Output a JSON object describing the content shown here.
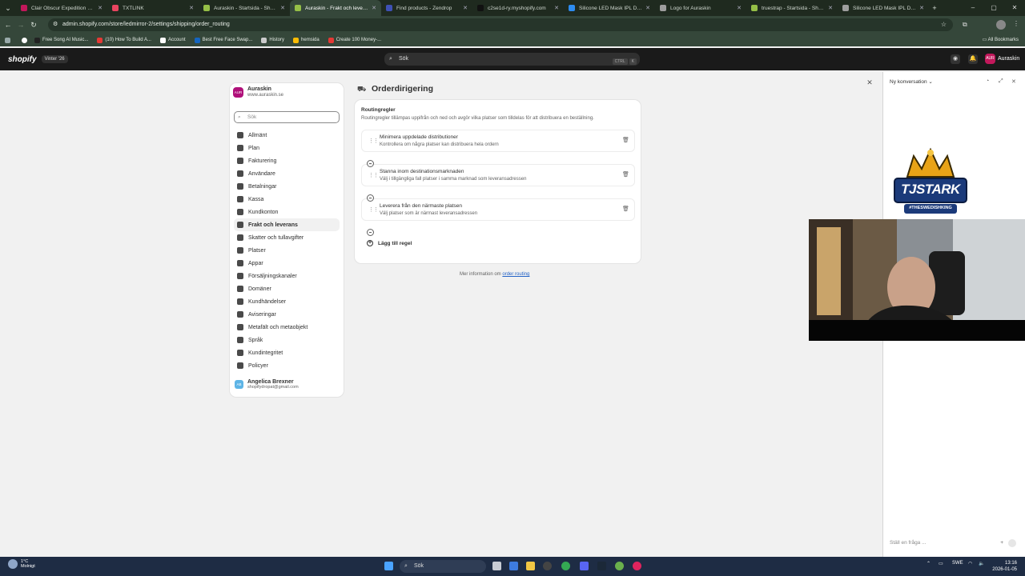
{
  "browser": {
    "tabs": [
      {
        "label": "Clair Obscur Expedition 33 – E",
        "color": "#c2185b"
      },
      {
        "label": "TXTLINK",
        "color": "#e94560"
      },
      {
        "label": "Auraskin - Startsida - Shopify",
        "color": "#95bf47"
      },
      {
        "label": "Auraskin - Frakt och leverans",
        "color": "#95bf47",
        "active": true
      },
      {
        "label": "Find products - Zendrop",
        "color": "#3f51b5"
      },
      {
        "label": "c2se1d-ry.myshopify.com",
        "color": "#111111"
      },
      {
        "label": "Silicone LED Mask IPL Device",
        "color": "#2d8cf0"
      },
      {
        "label": "Logo for Auraskin",
        "color": "#9e9e9e"
      },
      {
        "label": "truestrap - Startsida - Shopify",
        "color": "#95bf47"
      },
      {
        "label": "Silicone LED Mask IPL Device",
        "color": "#9e9e9e"
      }
    ],
    "url": "admin.shopify.com/store/ledmirror-2/settings/shipping/order_routing",
    "bookmarks": [
      {
        "label": "Free Song AI Music...",
        "color": "#222"
      },
      {
        "label": "(10) How To Build A...",
        "color": "#e53935"
      },
      {
        "label": "Account",
        "color": "#ffffff"
      },
      {
        "label": "Best Free Face Swap...",
        "color": "#1565c0"
      },
      {
        "label": "History",
        "color": "#cccccc"
      },
      {
        "label": "hemsida",
        "color": "#fbbc05"
      },
      {
        "label": "Create 100 Money-...",
        "color": "#e53935"
      }
    ],
    "all_bookmarks": "All Bookmarks"
  },
  "shopify": {
    "logo": "shopify",
    "edition": "Vinter '26",
    "search_placeholder": "Sök",
    "kbd1": "CTRL",
    "kbd2": "K",
    "store_initials": "AUR",
    "store_button": "Auraskin"
  },
  "sidebar": {
    "store_initials": "AUR",
    "store_name": "Auraskin",
    "store_url": "www.auraskin.se",
    "search_placeholder": "Sök",
    "items": [
      {
        "label": "Allmänt"
      },
      {
        "label": "Plan"
      },
      {
        "label": "Fakturering"
      },
      {
        "label": "Användare"
      },
      {
        "label": "Betalningar"
      },
      {
        "label": "Kassa"
      },
      {
        "label": "Kundkonton"
      },
      {
        "label": "Frakt och leverans",
        "selected": true
      },
      {
        "label": "Skatter och tullavgifter"
      },
      {
        "label": "Platser"
      },
      {
        "label": "Appar"
      },
      {
        "label": "Försäljningskanaler"
      },
      {
        "label": "Domäner"
      },
      {
        "label": "Kundhändelser"
      },
      {
        "label": "Aviseringar"
      },
      {
        "label": "Metafält och metaobjekt"
      },
      {
        "label": "Språk"
      },
      {
        "label": "Kundintegritet"
      },
      {
        "label": "Policyer"
      }
    ],
    "user_initials": "AB",
    "user_name": "Angelica Brexner",
    "user_email": "shopifydropat@gmail.com"
  },
  "page": {
    "title": "Orderdirigering",
    "card_heading": "Routingregler",
    "card_description": "Routingregler tillämpas uppifrån och ned och avgör vilka platser som tilldelas för att distribuera en beställning.",
    "rules": [
      {
        "title": "Minimera uppdelade distributioner",
        "subtitle": "Kontrollera om några platser kan distribuera hela ordern"
      },
      {
        "title": "Stanna inom destinationsmarknaden",
        "subtitle": "Välj i tillgängliga fall platser i samma marknad som leveransadressen"
      },
      {
        "title": "Leverera från den närmaste platsen",
        "subtitle": "Välj platser som är närmast leveransadressen"
      }
    ],
    "add_rule": "Lägg till regel",
    "more_info_prefix": "Mer information om",
    "more_info_link": "order routing"
  },
  "sidekick": {
    "title": "Ny konversation",
    "ask_placeholder": "Ställ en fråga ..."
  },
  "overlay": {
    "logo_text": "TJSTARK",
    "logo_subtext": "#THESWEDISHKING"
  },
  "taskbar": {
    "weather_temp": "1°C",
    "weather_desc": "Molnigt",
    "search": "Sök",
    "lang": "SWE",
    "time": "13:16",
    "date": "2026-01-05"
  }
}
